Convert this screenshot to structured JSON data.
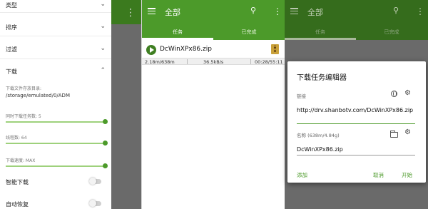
{
  "settings_panel": {
    "items": [
      {
        "label": "类型",
        "icon": "chevron-down"
      },
      {
        "label": "排序",
        "icon": "chevron-down"
      },
      {
        "label": "过滤",
        "icon": "chevron-down"
      },
      {
        "label": "下载",
        "icon": "chevron-up"
      }
    ],
    "download_dir_label": "下载文件存放目录:",
    "download_dir_value": "/storage/emulated/0/ADM",
    "sliders": [
      {
        "label": "同时下载任务数: 5",
        "level": 1.0
      },
      {
        "label": "线程数: 64",
        "level": 1.0
      },
      {
        "label": "下载速度: MAX",
        "level": 1.0
      }
    ],
    "toggles": [
      {
        "label": "智能下载",
        "on": false
      },
      {
        "label": "自动恢复",
        "on": false
      }
    ]
  },
  "main": {
    "title": "全部",
    "tabs": [
      {
        "label": "任务",
        "active": true
      },
      {
        "label": "已完成",
        "active": false
      }
    ],
    "task": {
      "name": "DcWinXPx86.zip",
      "downloaded": "2.18m/638m",
      "speed": "36.5kB/s",
      "time": "00:28/55:11"
    }
  },
  "dialog": {
    "title": "下载任务编辑器",
    "link_label": "链接",
    "url": "http://drv.shanbotv.com/DcWinXPx86.zip",
    "name_label": "名称 (638m/4.84g)",
    "filename": "DcWinXPx86.zip",
    "add_label": "添加",
    "cancel_label": "取消",
    "start_label": "开始"
  },
  "colors": {
    "accent": "#4c9a2a",
    "accent_dark": "#356c1c",
    "scrim": "#6a6a6a"
  }
}
